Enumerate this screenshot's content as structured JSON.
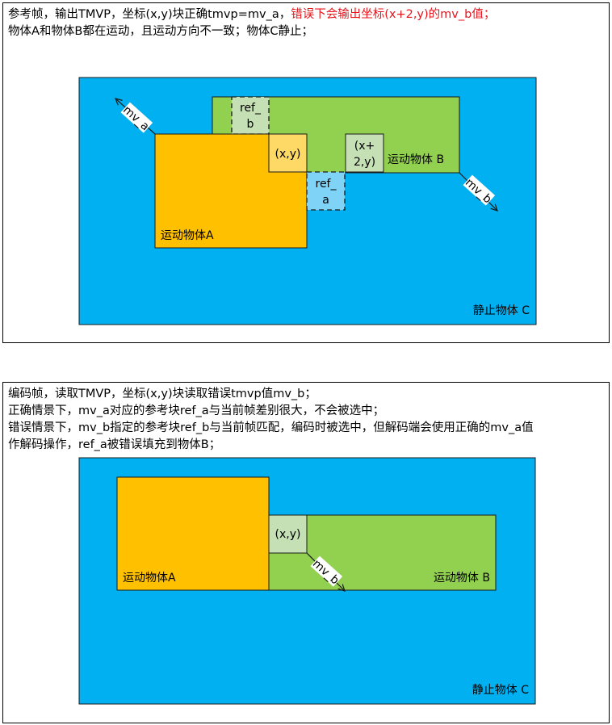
{
  "panel1": {
    "line1_a": "参考帧，输出TMVP，坐标(x,y)块正确tmvp=mv_a，",
    "line1_b": "错误下会输出坐标(x+2,y)的mv_b值；",
    "line2": "物体A和物体B都在运动，且运动方向不一致；物体C静止；",
    "labels": {
      "static_c": "静止物体 C",
      "moving_a": "运动物体A",
      "moving_b": "运动物体 B",
      "xy": "(x,y)",
      "x2_line1": "(x+",
      "x2_line2": "2,y)",
      "ref_b_line1": "ref_",
      "ref_b_line2": "b",
      "ref_a_line1": "ref_",
      "ref_a_line2": "a",
      "mv_a": "mv_a",
      "mv_b": "mv_b"
    }
  },
  "panel2": {
    "line1": "编码帧，读取TMVP，坐标(x,y)块读取错误tmvp值mv_b；",
    "line2": "正确情景下，mv_a对应的参考块ref_a与当前帧差别很大，不会被选中；",
    "line3": "错误情景下，mv_b指定的参考块ref_b与当前帧匹配，编码时被选中，但解码端会使用正确的mv_a值",
    "line4": "作解码操作，ref_a被错误填充到物体B；",
    "labels": {
      "static_c": "静止物体 C",
      "moving_a": "运动物体A",
      "moving_b": "运动物体 B",
      "xy": "(x,y)",
      "mv_b": "mv_b"
    }
  },
  "colors": {
    "static_c": "#00b0f0",
    "moving_a": "#ffc000",
    "moving_b": "#92d050",
    "xy_block_top": "#ffd966",
    "x2_block": "#c5e0b4",
    "ref_b": "#c5e0b4",
    "ref_a": "#7fd3f7",
    "xy_block_bottom": "#c5e0b4"
  }
}
